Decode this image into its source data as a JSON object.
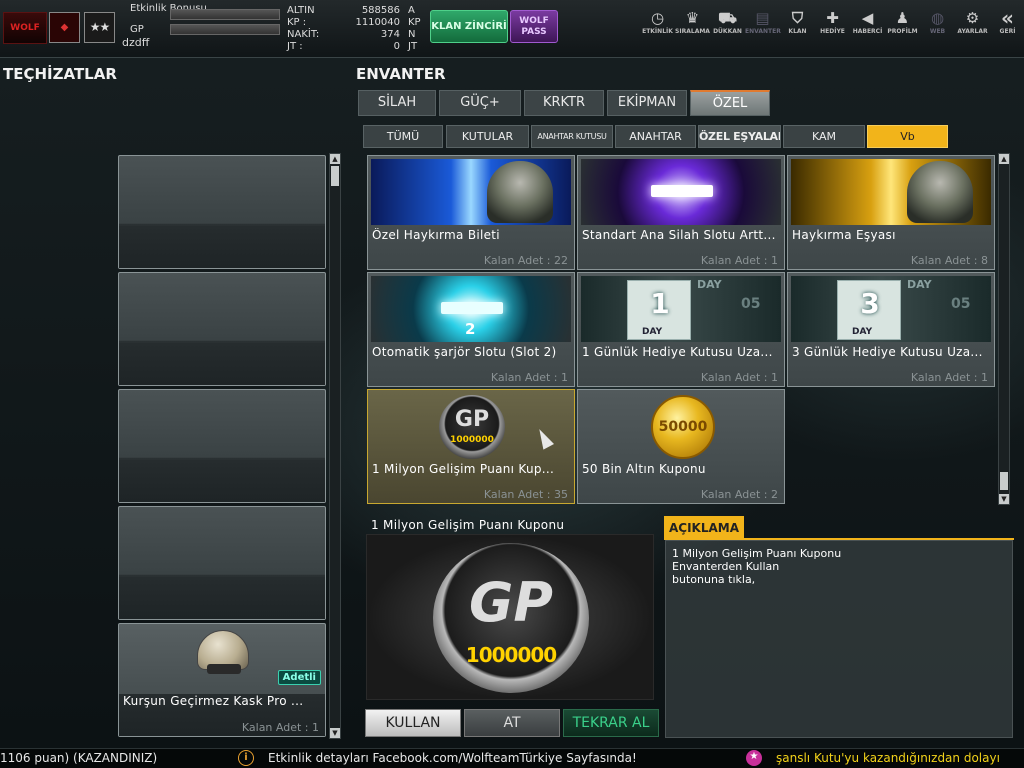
{
  "player": {
    "labels": {
      "etkinlik_bonusu": "Etkinlik Bonusu",
      "gp": "GP"
    },
    "username": "dzdff",
    "currencies": [
      {
        "name": "ALTIN",
        "value": "588586",
        "unit": "A"
      },
      {
        "name": "KP   :",
        "value": "1110040",
        "unit": "KP"
      },
      {
        "name": "NAKİT:",
        "value": "374",
        "unit": "N"
      },
      {
        "name": "JT   :",
        "value": "0",
        "unit": "JT"
      }
    ]
  },
  "top_buttons": {
    "klan": "KLAN ZİNCİRİ",
    "wolf": "WOLF PASS"
  },
  "nav": [
    {
      "label": "ETKİNLİK",
      "icon": "clock-icon",
      "glyph": "◷"
    },
    {
      "label": "SIRALAMA",
      "icon": "ranking-icon",
      "glyph": "♛"
    },
    {
      "label": "DÜKKAN",
      "icon": "cart-icon",
      "glyph": "⛟"
    },
    {
      "label": "ENVANTER",
      "icon": "inventory-icon",
      "glyph": "▤"
    },
    {
      "label": "KLAN",
      "icon": "shield-icon",
      "glyph": "⛉"
    },
    {
      "label": "HEDİYE",
      "icon": "gift-icon",
      "glyph": "✚"
    },
    {
      "label": "HABERCİ",
      "icon": "megaphone-icon",
      "glyph": "◀"
    },
    {
      "label": "PROFİLM",
      "icon": "profile-icon",
      "glyph": "♟"
    },
    {
      "label": "WEB",
      "icon": "globe-icon",
      "glyph": "◍"
    },
    {
      "label": "AYARLAR",
      "icon": "gear-icon",
      "glyph": "⚙"
    },
    {
      "label": "GERİ",
      "icon": "back-icon",
      "glyph": "«"
    }
  ],
  "equipment": {
    "title": "TEÇHİZATLAR",
    "filled_slot": {
      "name": "Kurşun Geçirmez Kask Pro ...",
      "count": "Kalan Adet : 1",
      "badge": "Adetli"
    }
  },
  "inventory": {
    "title": "ENVANTER",
    "main_tabs": [
      "SİLAH",
      "GÜÇ+",
      "KRKTR",
      "EKİPMAN",
      "ÖZEL"
    ],
    "sub_tabs": [
      "TÜMÜ",
      "KUTULAR",
      "ANAHTAR KUTUSU",
      "ANAHTAR",
      "ÖZEL EŞYALAR",
      "KAM",
      "Vb"
    ],
    "items": [
      {
        "name": "Özel Haykırma Bileti",
        "count": "Kalan Adet : 22"
      },
      {
        "name": "Standart Ana Silah Slotu Artt...",
        "count": "Kalan Adet : 1"
      },
      {
        "name": "Haykırma Eşyası",
        "count": "Kalan Adet : 8"
      },
      {
        "name": "Otomatik şarjör Slotu (Slot 2)",
        "count": "Kalan Adet : 1",
        "thumb_text": "2"
      },
      {
        "name": "1 Günlük Hediye Kutusu Uza...",
        "count": "Kalan Adet : 1",
        "thumb_num": "1",
        "thumb_day": "DAY",
        "thumb_side": "05"
      },
      {
        "name": "3 Günlük Hediye Kutusu Uza...",
        "count": "Kalan Adet : 1",
        "thumb_num": "3",
        "thumb_day": "DAY",
        "thumb_side": "05"
      },
      {
        "name": "1 Milyon Gelişim Puanı Kup...",
        "count": "Kalan Adet : 35",
        "thumb_text": "GP",
        "thumb_val": "1000000"
      },
      {
        "name": "50 Bin Altın Kuponu",
        "count": "Kalan Adet : 2",
        "thumb_text": "50000"
      }
    ]
  },
  "detail": {
    "title": "1 Milyon Gelişim Puanı Kuponu",
    "coin_text": "GP",
    "coin_value": "1000000",
    "buttons": {
      "use": "KULLAN",
      "drop": "AT",
      "repeat": "TEKRAR AL"
    }
  },
  "description": {
    "header": "AÇIKLAMA",
    "lines": [
      "1 Milyon Gelişim Puanı Kuponu",
      "Envanterden Kullan",
      "butonuna tıkla,"
    ]
  },
  "ticker": {
    "left": "1106 puan) (KAZANDINIZ)",
    "middle": "Etkinlik detayları Facebook.com/WolfteamTürkiye Sayfasında!",
    "right": "şanslı Kutu'yu kazandığınızdan dolayı"
  },
  "colors": {
    "accent": "#f2b41a",
    "ticker_middle": "#e8e8e8",
    "ticker_right": "#f2d21a",
    "ticker_icon_right": "#c8309a"
  }
}
